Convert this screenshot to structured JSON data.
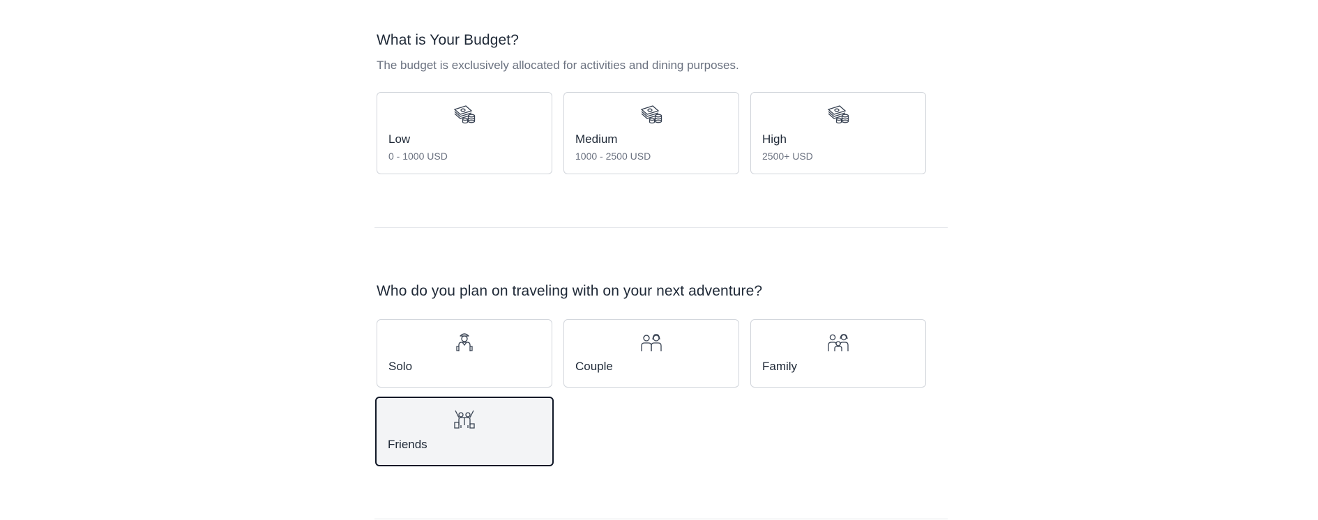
{
  "budget": {
    "title": "What is Your Budget?",
    "subtitle": "The budget is exclusively allocated for activities and dining purposes.",
    "options": [
      {
        "label": "Low",
        "desc": "0 - 1000 USD",
        "icon": "money-stack-icon"
      },
      {
        "label": "Medium",
        "desc": "1000 - 2500 USD",
        "icon": "money-stack-icon"
      },
      {
        "label": "High",
        "desc": "2500+ USD",
        "icon": "money-stack-icon"
      }
    ]
  },
  "travel": {
    "title": "Who do you plan on traveling with on your next adventure?",
    "options": [
      {
        "label": "Solo",
        "icon": "solo-traveler-icon",
        "selected": false
      },
      {
        "label": "Couple",
        "icon": "couple-icon",
        "selected": false
      },
      {
        "label": "Family",
        "icon": "family-icon",
        "selected": false
      },
      {
        "label": "Friends",
        "icon": "friends-icon",
        "selected": true
      }
    ]
  },
  "colors": {
    "text": "#1f2937",
    "muted": "#6b7280",
    "border": "#d1d5db",
    "selected_bg": "#f3f4f6",
    "selected_border": "#111827"
  }
}
